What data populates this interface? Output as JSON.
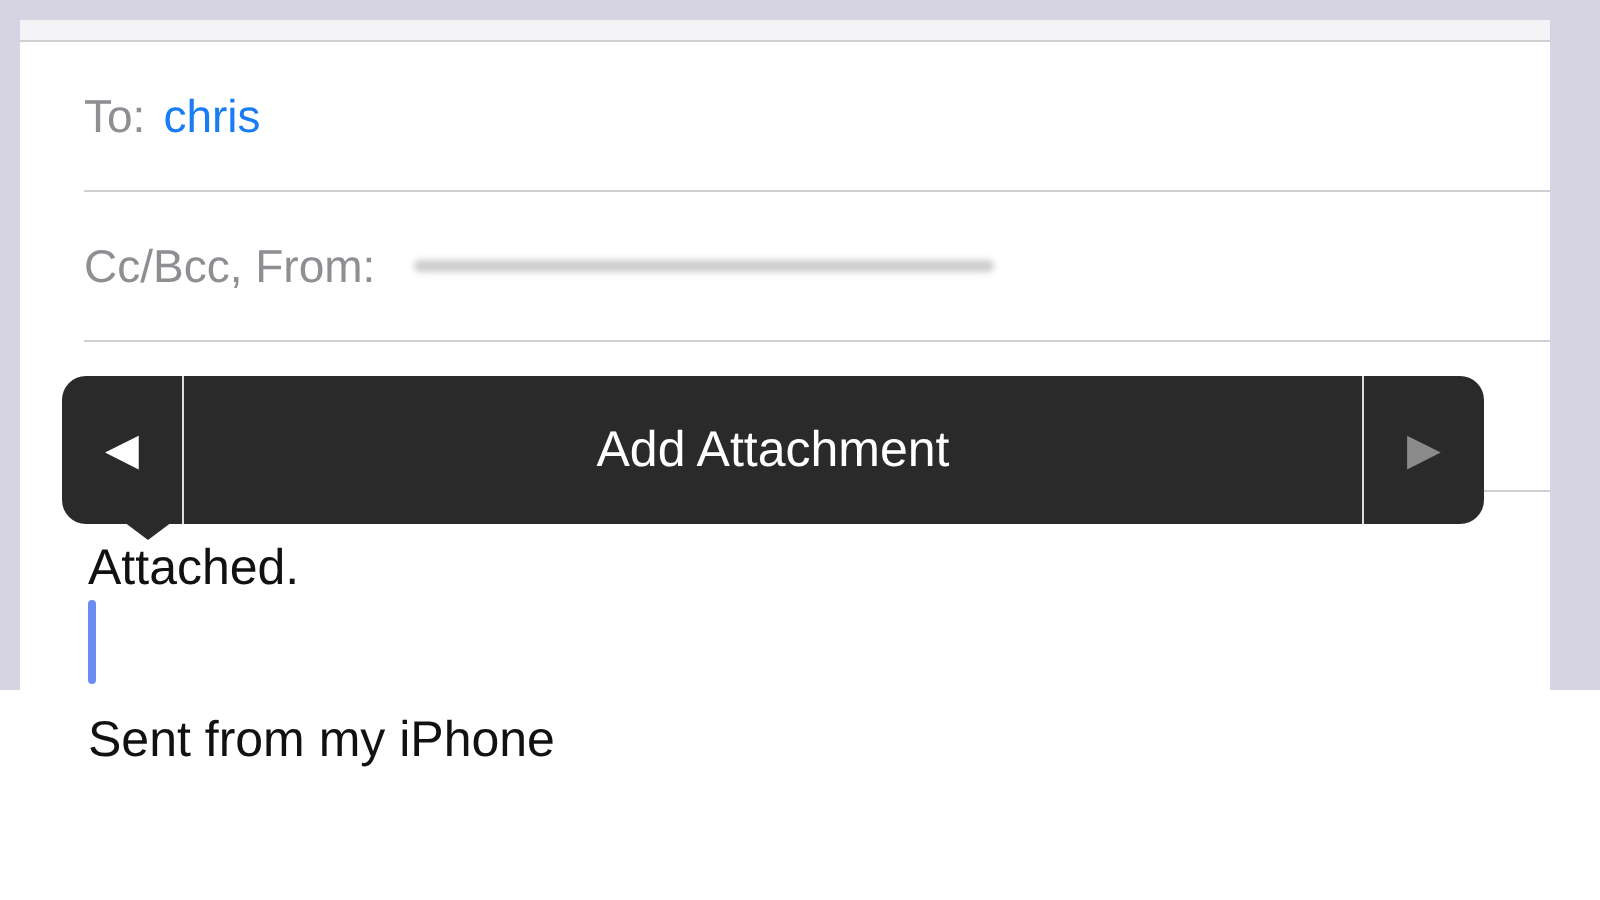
{
  "header_fields": [
    {
      "kind": "recipient",
      "label": "To:",
      "value": "chris"
    },
    {
      "kind": "redacted",
      "label": "Cc/Bcc, From:"
    }
  ],
  "edit_menu": {
    "prev": {
      "label": "◀",
      "disabled": false
    },
    "action": "Add Attachment",
    "next": {
      "label": "▶",
      "disabled": true
    }
  },
  "body": {
    "lines": [
      {
        "kind": "text",
        "text": "Attached."
      },
      {
        "kind": "cursor"
      },
      {
        "kind": "text",
        "text": "Sent from my iPhone"
      }
    ]
  }
}
